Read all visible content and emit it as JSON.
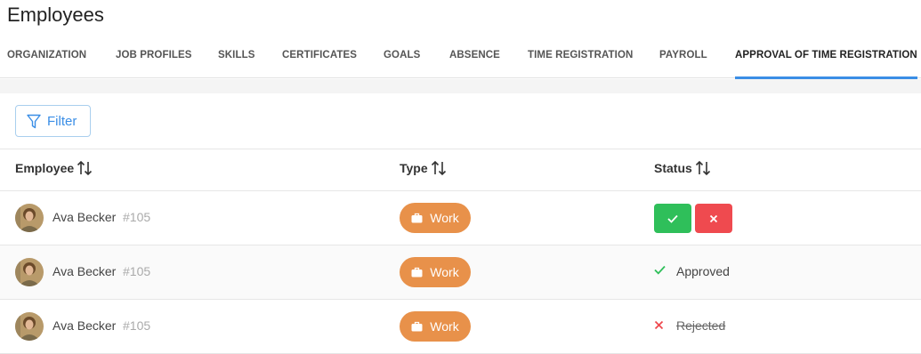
{
  "page": {
    "title": "Employees"
  },
  "tabs": [
    {
      "label": "ORGANIZATION"
    },
    {
      "label": "JOB PROFILES"
    },
    {
      "label": "SKILLS"
    },
    {
      "label": "CERTIFICATES"
    },
    {
      "label": "GOALS"
    },
    {
      "label": "ABSENCE"
    },
    {
      "label": "TIME REGISTRATION"
    },
    {
      "label": "PAYROLL"
    },
    {
      "label": "APPROVAL OF TIME REGISTRATION",
      "active": true
    }
  ],
  "toolbar": {
    "filter_label": "Filter",
    "filter_icon": "funnel-icon"
  },
  "table": {
    "columns": [
      {
        "label": "Employee",
        "sort_icon": "sort-icon"
      },
      {
        "label": "Type",
        "sort_icon": "sort-icon"
      },
      {
        "label": "Status",
        "sort_icon": "sort-icon"
      }
    ],
    "rows": [
      {
        "name": "Ava Becker",
        "id": "#105",
        "type": "Work",
        "status": "pending"
      },
      {
        "name": "Ava Becker",
        "id": "#105",
        "type": "Work",
        "status": "approved",
        "status_label": "Approved"
      },
      {
        "name": "Ava Becker",
        "id": "#105",
        "type": "Work",
        "status": "rejected",
        "status_label": "Rejected"
      }
    ]
  },
  "colors": {
    "accent": "#3a8ee6",
    "work_badge": "#e8914a",
    "approve": "#2fbf5a",
    "reject": "#ef4a4f"
  }
}
